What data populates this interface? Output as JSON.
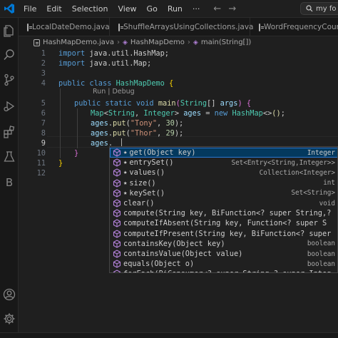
{
  "titlebar": {
    "menu": [
      "File",
      "Edit",
      "Selection",
      "View",
      "Go",
      "Run"
    ],
    "more": "···",
    "search_text": "my fo",
    "accent": "#0078d4"
  },
  "activitybar": {
    "icons": [
      "explorer-icon",
      "search-icon",
      "source-control-icon",
      "run-debug-icon",
      "extensions-icon",
      "testing-icon",
      "b-extension-icon",
      "account-icon",
      "settings-icon"
    ],
    "b_label": "B"
  },
  "tabs": [
    {
      "label": "LocalDateDemo.java"
    },
    {
      "label": "ShuffleArraysUsingCollections.java"
    },
    {
      "label": "WordFrequencyCounte"
    }
  ],
  "breadcrumb": {
    "file": "HashMapDemo.java",
    "class": "HashMapDemo",
    "method": "main(String[])"
  },
  "editor": {
    "line_numbers": [
      "1",
      "2",
      "3",
      "4",
      "5",
      "6",
      "7",
      "8",
      "9",
      "10",
      "11",
      "12"
    ],
    "codelens": "Run | Debug",
    "lines": {
      "l1": [
        "import",
        " java.util.HashMap;"
      ],
      "l2": [
        "import",
        " java.util.Map;"
      ],
      "l4": [
        "public",
        "class",
        "HashMapDemo",
        "{"
      ],
      "l5": [
        "public",
        "static",
        "void",
        "main",
        "(",
        "String",
        "[]",
        "args",
        ")",
        "{"
      ],
      "l6": [
        "Map",
        "<",
        "String",
        ", ",
        "Integer",
        ">",
        "ages",
        " = ",
        "new",
        "HashMap",
        "<>",
        "()",
        ";"
      ],
      "l7": [
        "ages",
        ".",
        "put",
        "(",
        "\"Tony\"",
        ", ",
        "30",
        ");"
      ],
      "l8": [
        "ages",
        ".",
        "put",
        "(",
        "\"Thor\"",
        ", ",
        "29",
        ");"
      ],
      "l9": [
        "ages",
        "."
      ],
      "l10": [
        "}"
      ],
      "l11": [
        "}"
      ]
    }
  },
  "suggest": {
    "items": [
      {
        "star": true,
        "label": "get(Object key)",
        "match": "",
        "type": "Integer",
        "selected": true
      },
      {
        "star": true,
        "label": "entrySet()",
        "match": "",
        "type": "Set<Entry<String,Integer>>"
      },
      {
        "star": true,
        "label": "values()",
        "match": "",
        "type": "Collection<Integer>"
      },
      {
        "star": true,
        "label": "size()",
        "match": "",
        "type": "int"
      },
      {
        "star": true,
        "label": "keySet()",
        "match": "",
        "type": "Set<String>"
      },
      {
        "star": false,
        "label": "clear()",
        "match": "",
        "type": "void"
      },
      {
        "star": false,
        "label": "compute(String key, BiFunction<? super String,? s",
        "match": "",
        "type": ""
      },
      {
        "star": false,
        "label": "computeIfAbsent(String key, Function<? super S",
        "match": "",
        "type": ""
      },
      {
        "star": false,
        "label": "computeIfPresent(String key, BiFunction<? super",
        "match": "",
        "type": ""
      },
      {
        "star": false,
        "label": "containsKey(Object key)",
        "match": "",
        "type": "boolean"
      },
      {
        "star": false,
        "label": "containsValue(Object value)",
        "match": "",
        "type": "boolean"
      },
      {
        "star": false,
        "label": "equals(Object o)",
        "match": "",
        "type": "boolean"
      },
      {
        "star": false,
        "label": "forEach(BiConsumer<? super String,? super Integ",
        "match": "",
        "type": ""
      }
    ]
  },
  "statusbar": {
    "items": [
      "",
      "",
      "",
      ""
    ]
  }
}
